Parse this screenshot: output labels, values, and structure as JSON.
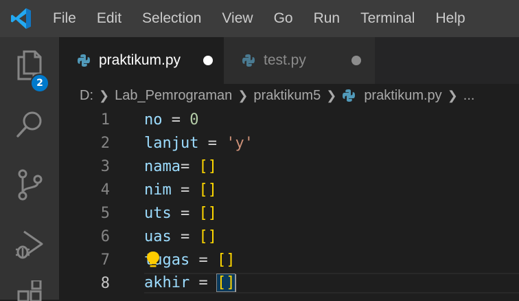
{
  "menubar": {
    "app_icon": "vscode-logo-icon",
    "items": [
      "File",
      "Edit",
      "Selection",
      "View",
      "Go",
      "Run",
      "Terminal",
      "Help"
    ]
  },
  "activitybar": {
    "items": [
      "explorer-icon",
      "search-icon",
      "source-control-icon",
      "run-debug-icon",
      "extensions-icon"
    ],
    "explorer_badge": "2"
  },
  "tabs": [
    {
      "label": "praktikum.py",
      "active": true,
      "dirty": true,
      "icon": "python-icon"
    },
    {
      "label": "test.py",
      "active": false,
      "dirty": true,
      "icon": "python-icon"
    }
  ],
  "breadcrumb": {
    "segments": [
      "D:",
      "Lab_Pemrograman",
      "praktikum5",
      "praktikum.py",
      "..."
    ],
    "file_icon": "python-icon"
  },
  "editor": {
    "active_line": 8,
    "lines": [
      {
        "n": "1",
        "var": "no",
        "op": " = ",
        "val": "0",
        "kind": "num"
      },
      {
        "n": "2",
        "var": "lanjut",
        "op": " = ",
        "val": "'y'",
        "kind": "str"
      },
      {
        "n": "3",
        "var": "nama",
        "op": "= ",
        "val": "[]",
        "kind": "br"
      },
      {
        "n": "4",
        "var": "nim",
        "op": " = ",
        "val": "[]",
        "kind": "br"
      },
      {
        "n": "5",
        "var": "uts",
        "op": " = ",
        "val": "[]",
        "kind": "br"
      },
      {
        "n": "6",
        "var": "uas",
        "op": " = ",
        "val": "[]",
        "kind": "br"
      },
      {
        "n": "7",
        "var": "tugas",
        "op": " = ",
        "val": "[]",
        "kind": "br"
      },
      {
        "n": "8",
        "var": "akhir",
        "op": " = ",
        "val": "[]",
        "kind": "br"
      }
    ],
    "lightbulb_icon": "lightbulb-icon"
  },
  "colors": {
    "accent": "#007acc",
    "variable": "#9cdcfe",
    "number": "#b5cea8",
    "string": "#ce9178",
    "bracket": "#ffd700",
    "lightbulb": "#ffcc00"
  }
}
